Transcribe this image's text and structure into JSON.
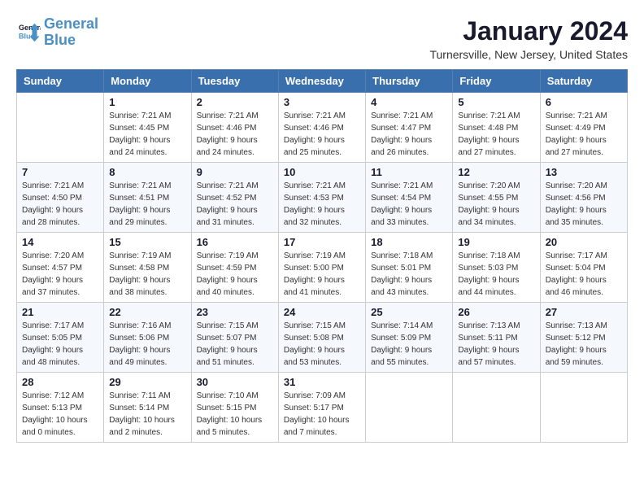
{
  "logo": {
    "line1": "General",
    "line2": "Blue"
  },
  "title": "January 2024",
  "location": "Turnersville, New Jersey, United States",
  "days_of_week": [
    "Sunday",
    "Monday",
    "Tuesday",
    "Wednesday",
    "Thursday",
    "Friday",
    "Saturday"
  ],
  "weeks": [
    [
      {
        "day": "",
        "info": ""
      },
      {
        "day": "1",
        "info": "Sunrise: 7:21 AM\nSunset: 4:45 PM\nDaylight: 9 hours\nand 24 minutes."
      },
      {
        "day": "2",
        "info": "Sunrise: 7:21 AM\nSunset: 4:46 PM\nDaylight: 9 hours\nand 24 minutes."
      },
      {
        "day": "3",
        "info": "Sunrise: 7:21 AM\nSunset: 4:46 PM\nDaylight: 9 hours\nand 25 minutes."
      },
      {
        "day": "4",
        "info": "Sunrise: 7:21 AM\nSunset: 4:47 PM\nDaylight: 9 hours\nand 26 minutes."
      },
      {
        "day": "5",
        "info": "Sunrise: 7:21 AM\nSunset: 4:48 PM\nDaylight: 9 hours\nand 27 minutes."
      },
      {
        "day": "6",
        "info": "Sunrise: 7:21 AM\nSunset: 4:49 PM\nDaylight: 9 hours\nand 27 minutes."
      }
    ],
    [
      {
        "day": "7",
        "info": "Sunrise: 7:21 AM\nSunset: 4:50 PM\nDaylight: 9 hours\nand 28 minutes."
      },
      {
        "day": "8",
        "info": "Sunrise: 7:21 AM\nSunset: 4:51 PM\nDaylight: 9 hours\nand 29 minutes."
      },
      {
        "day": "9",
        "info": "Sunrise: 7:21 AM\nSunset: 4:52 PM\nDaylight: 9 hours\nand 31 minutes."
      },
      {
        "day": "10",
        "info": "Sunrise: 7:21 AM\nSunset: 4:53 PM\nDaylight: 9 hours\nand 32 minutes."
      },
      {
        "day": "11",
        "info": "Sunrise: 7:21 AM\nSunset: 4:54 PM\nDaylight: 9 hours\nand 33 minutes."
      },
      {
        "day": "12",
        "info": "Sunrise: 7:20 AM\nSunset: 4:55 PM\nDaylight: 9 hours\nand 34 minutes."
      },
      {
        "day": "13",
        "info": "Sunrise: 7:20 AM\nSunset: 4:56 PM\nDaylight: 9 hours\nand 35 minutes."
      }
    ],
    [
      {
        "day": "14",
        "info": "Sunrise: 7:20 AM\nSunset: 4:57 PM\nDaylight: 9 hours\nand 37 minutes."
      },
      {
        "day": "15",
        "info": "Sunrise: 7:19 AM\nSunset: 4:58 PM\nDaylight: 9 hours\nand 38 minutes."
      },
      {
        "day": "16",
        "info": "Sunrise: 7:19 AM\nSunset: 4:59 PM\nDaylight: 9 hours\nand 40 minutes."
      },
      {
        "day": "17",
        "info": "Sunrise: 7:19 AM\nSunset: 5:00 PM\nDaylight: 9 hours\nand 41 minutes."
      },
      {
        "day": "18",
        "info": "Sunrise: 7:18 AM\nSunset: 5:01 PM\nDaylight: 9 hours\nand 43 minutes."
      },
      {
        "day": "19",
        "info": "Sunrise: 7:18 AM\nSunset: 5:03 PM\nDaylight: 9 hours\nand 44 minutes."
      },
      {
        "day": "20",
        "info": "Sunrise: 7:17 AM\nSunset: 5:04 PM\nDaylight: 9 hours\nand 46 minutes."
      }
    ],
    [
      {
        "day": "21",
        "info": "Sunrise: 7:17 AM\nSunset: 5:05 PM\nDaylight: 9 hours\nand 48 minutes."
      },
      {
        "day": "22",
        "info": "Sunrise: 7:16 AM\nSunset: 5:06 PM\nDaylight: 9 hours\nand 49 minutes."
      },
      {
        "day": "23",
        "info": "Sunrise: 7:15 AM\nSunset: 5:07 PM\nDaylight: 9 hours\nand 51 minutes."
      },
      {
        "day": "24",
        "info": "Sunrise: 7:15 AM\nSunset: 5:08 PM\nDaylight: 9 hours\nand 53 minutes."
      },
      {
        "day": "25",
        "info": "Sunrise: 7:14 AM\nSunset: 5:09 PM\nDaylight: 9 hours\nand 55 minutes."
      },
      {
        "day": "26",
        "info": "Sunrise: 7:13 AM\nSunset: 5:11 PM\nDaylight: 9 hours\nand 57 minutes."
      },
      {
        "day": "27",
        "info": "Sunrise: 7:13 AM\nSunset: 5:12 PM\nDaylight: 9 hours\nand 59 minutes."
      }
    ],
    [
      {
        "day": "28",
        "info": "Sunrise: 7:12 AM\nSunset: 5:13 PM\nDaylight: 10 hours\nand 0 minutes."
      },
      {
        "day": "29",
        "info": "Sunrise: 7:11 AM\nSunset: 5:14 PM\nDaylight: 10 hours\nand 2 minutes."
      },
      {
        "day": "30",
        "info": "Sunrise: 7:10 AM\nSunset: 5:15 PM\nDaylight: 10 hours\nand 5 minutes."
      },
      {
        "day": "31",
        "info": "Sunrise: 7:09 AM\nSunset: 5:17 PM\nDaylight: 10 hours\nand 7 minutes."
      },
      {
        "day": "",
        "info": ""
      },
      {
        "day": "",
        "info": ""
      },
      {
        "day": "",
        "info": ""
      }
    ]
  ]
}
